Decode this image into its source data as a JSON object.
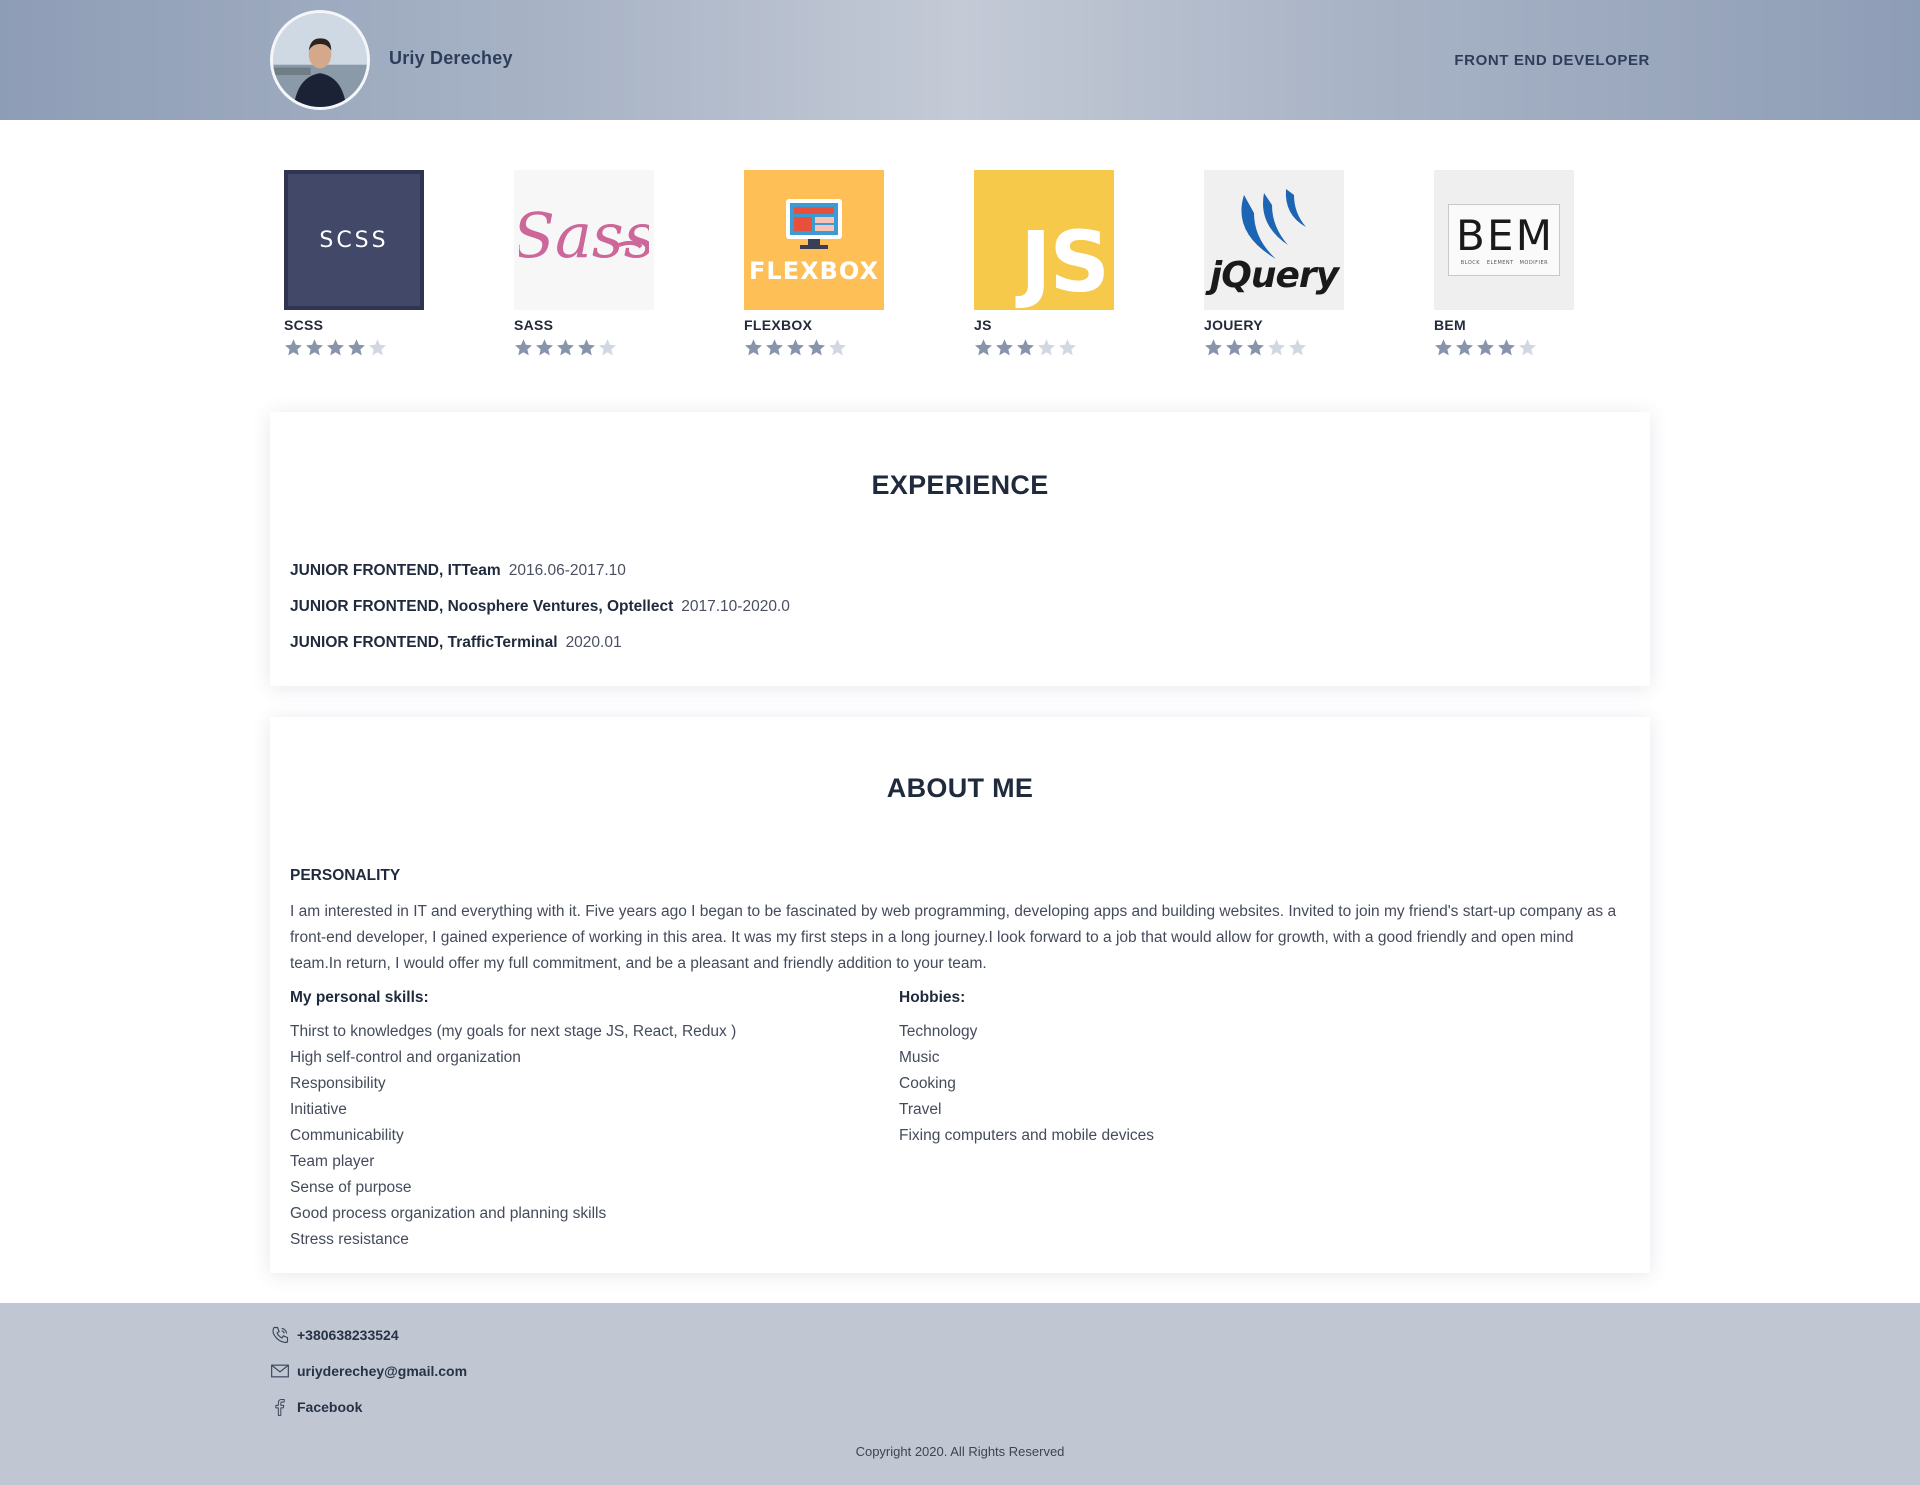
{
  "header": {
    "name": "Uriy Derechey",
    "role": "FRONT END DEVELOPER"
  },
  "skills": [
    {
      "name": "SCSS",
      "logo_text": "SCSS",
      "rating": 4,
      "max": 5
    },
    {
      "name": "SASS",
      "logo_text": "Sass",
      "rating": 4,
      "max": 5
    },
    {
      "name": "FLEXBOX",
      "logo_text": "FLEXBOX",
      "rating": 4,
      "max": 5
    },
    {
      "name": "JS",
      "logo_text": "JS",
      "rating": 3,
      "max": 5
    },
    {
      "name": "JOUERY",
      "logo_text": "jQuery",
      "rating": 3,
      "max": 5
    },
    {
      "name": "BEM",
      "logo_text": "BEM",
      "logo_sublabels": [
        "BLOCK",
        "ELEMENT",
        "MODIFIER"
      ],
      "rating": 4,
      "max": 5
    }
  ],
  "experience": {
    "title": "EXPERIENCE",
    "jobs": [
      {
        "title": "JUNIOR FRONTEND, ITTeam",
        "dates": "2016.06-2017.10"
      },
      {
        "title": "JUNIOR FRONTEND, Noosphere Ventures, Optellect",
        "dates": "2017.10-2020.0"
      },
      {
        "title": "JUNIOR FRONTEND, TrafficTerminal",
        "dates": "2020.01"
      }
    ]
  },
  "about": {
    "title": "ABOUT ME",
    "personality_heading": "PERSONALITY",
    "personality_text": "I am interested in IT and everything with it. Five years ago I began to be fascinated by web programming, developing apps and building websites. Invited to join my friend's start-up company as a front-end developer, I gained experience of working in this area. It was my first steps in a long journey.I look forward to a job that would allow for growth, with a good friendly and open mind team.In return, I would offer my full commitment, and be a pleasant and friendly addition to your team.",
    "skills_heading": "My personal skills:",
    "skills": [
      "Thirst to knowledges (my goals for next stage JS, React, Redux )",
      "High self-control and organization",
      "Responsibility",
      "Initiative",
      "Communicability",
      "Team player",
      "Sense of purpose",
      "Good process organization and planning skills",
      "Stress resistance"
    ],
    "hobbies_heading": "Hobbies:",
    "hobbies": [
      "Technology",
      "Music",
      "Cooking",
      "Travel",
      "Fixing computers and mobile devices"
    ]
  },
  "footer": {
    "phone": "+380638233524",
    "email": "uriyderechey@gmail.com",
    "facebook": "Facebook",
    "copyright": "Copyright 2020. All Rights Reserved"
  },
  "icons": {
    "phone": "phone-icon",
    "email": "envelope-icon",
    "facebook": "facebook-icon",
    "star": "star-icon"
  },
  "colors": {
    "header_gradient_edge": "#8e9db6",
    "header_gradient_center": "#c4cad6",
    "star_filled": "#8794ab",
    "star_empty": "#d1d8e2",
    "footer_bg": "#c0c7d3",
    "scss_bg": "#2f3450",
    "flexbox_bg": "#ffbf57",
    "js_bg": "#f7c94a",
    "jquery_blue": "#1b65b4",
    "sass_pink": "#cd6799"
  }
}
